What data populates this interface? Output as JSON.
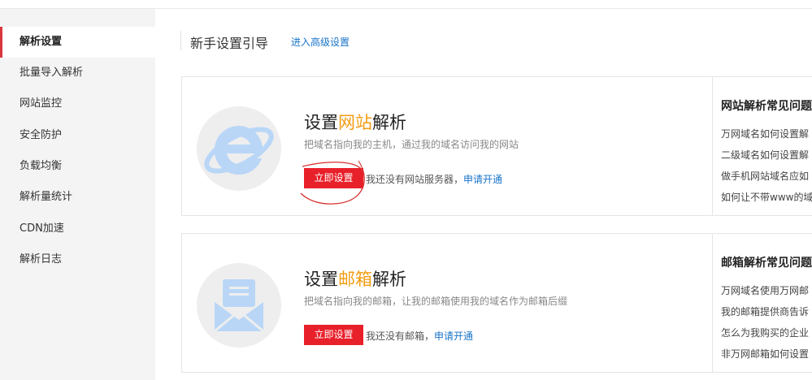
{
  "sidebar": {
    "items": [
      {
        "label": "解析设置",
        "active": true
      },
      {
        "label": "批量导入解析"
      },
      {
        "label": "网站监控"
      },
      {
        "label": "安全防护"
      },
      {
        "label": "负载均衡"
      },
      {
        "label": "解析量统计"
      },
      {
        "label": "CDN加速"
      },
      {
        "label": "解析日志"
      }
    ]
  },
  "header": {
    "title": "新手设置引导",
    "advanced_link": "进入高级设置"
  },
  "cards": [
    {
      "icon": "ie-browser-icon",
      "title_prefix": "设置",
      "title_highlight": "网站",
      "title_suffix": "解析",
      "description": "把域名指向我的主机，通过我的域名访问我的网站",
      "button_label": "立即设置",
      "note": "我还没有网站服务器，",
      "apply_link": "申请开通",
      "faq_title": "网站解析常见问题",
      "faq_items": [
        "万网域名如何设置解",
        "二级域名如何设置解",
        "做手机网站域名应如",
        "如何让不带www的域"
      ]
    },
    {
      "icon": "mail-envelope-icon",
      "title_prefix": "设置",
      "title_highlight": "邮箱",
      "title_suffix": "解析",
      "description": "把域名指向我的邮箱，让我的邮箱使用我的域名作为邮箱后缀",
      "button_label": "立即设置",
      "note": "我还没有邮箱，",
      "apply_link": "申请开通",
      "faq_title": "邮箱解析常见问题",
      "faq_items": [
        "万网域名使用万网邮",
        "我的邮箱提供商告诉",
        "怎么为我购买的企业",
        "非万网邮箱如何设置"
      ]
    }
  ],
  "colors": {
    "accent_red": "#e8202a",
    "highlight_orange": "#f39c12",
    "link_blue": "#1a74c9",
    "sidebar_bg": "#f4f4f4"
  }
}
